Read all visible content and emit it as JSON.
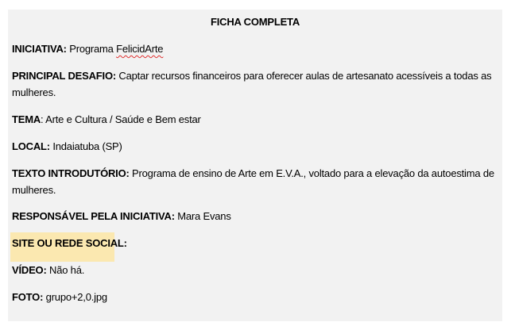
{
  "ficha": {
    "title": "FICHA COMPLETA",
    "fields": {
      "iniciativa": {
        "label": "INICIATIVA:",
        "value": "Programa ",
        "value_misspelled": "FelicidArte"
      },
      "desafio": {
        "label": "PRINCIPAL DESAFIO:",
        "value": "Captar recursos financeiros para oferecer aulas de artesanato acessíveis a todas as mulheres."
      },
      "tema": {
        "label": "TEMA",
        "sep": ":",
        "value": "Arte e Cultura / Saúde e Bem estar"
      },
      "local": {
        "label": "LOCAL:",
        "value": "Indaiatuba (SP)"
      },
      "texto": {
        "label": "TEXTO INTRODUTÓRIO:",
        "value": "Programa de ensino de Arte em E.V.A., voltado para a elevação da autoestima de mulheres."
      },
      "responsavel": {
        "label": "RESPONSÁVEL PELA INICIATIVA:",
        "value": "Mara Evans"
      },
      "site": {
        "label": "SITE OU REDE SOCIAL:",
        "value": ""
      },
      "video": {
        "label": "VÍDEO:",
        "value": "Não há."
      },
      "foto": {
        "label": "FOTO:",
        "value": "grupo+2,0.jpg"
      }
    }
  },
  "colors": {
    "sheet_background": "#f2f2f2",
    "highlight": "#fbe8b0",
    "spellcheck_underline": "#e03030"
  }
}
